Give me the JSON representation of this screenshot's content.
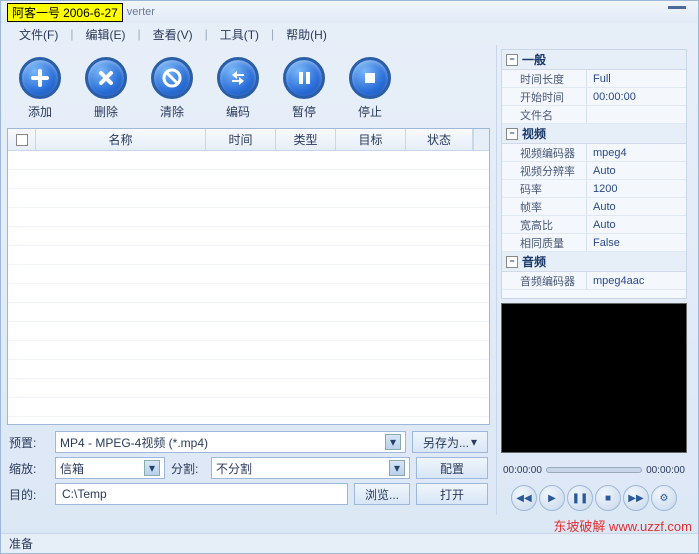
{
  "title": {
    "badge_name": "阿客一号",
    "badge_date": "2006-6-27",
    "suffix": "verter"
  },
  "menu": {
    "items": [
      "文件(F)",
      "编辑(E)",
      "查看(V)",
      "工具(T)",
      "帮助(H)"
    ]
  },
  "toolbar": {
    "add": "添加",
    "delete": "删除",
    "clear": "清除",
    "encode": "编码",
    "pause": "暂停",
    "stop": "停止"
  },
  "grid": {
    "cols": {
      "check": "",
      "name": "名称",
      "time": "时间",
      "type": "类型",
      "target": "目标",
      "status": "状态"
    }
  },
  "bottom": {
    "preset_label": "预置:",
    "preset_value": "MP4 - MPEG-4视频 (*.mp4)",
    "saveas": "另存为...",
    "scale_label": "缩放:",
    "scale_value": "信箱",
    "split_label": "分割:",
    "split_value": "不分割",
    "config": "配置",
    "dest_label": "目的:",
    "dest_value": "C:\\Temp",
    "browse": "浏览...",
    "open": "打开"
  },
  "props": {
    "g1": {
      "title": "一般",
      "rows": [
        {
          "k": "时间长度",
          "v": "Full"
        },
        {
          "k": "开始时间",
          "v": "00:00:00"
        },
        {
          "k": "文件名",
          "v": ""
        }
      ]
    },
    "g2": {
      "title": "视频",
      "rows": [
        {
          "k": "视频编码器",
          "v": "mpeg4"
        },
        {
          "k": "视频分辨率",
          "v": "Auto"
        },
        {
          "k": "码率",
          "v": "1200"
        },
        {
          "k": "帧率",
          "v": "Auto"
        },
        {
          "k": "宽高比",
          "v": "Auto"
        },
        {
          "k": "相同质量",
          "v": "False"
        }
      ]
    },
    "g3": {
      "title": "音频",
      "rows": [
        {
          "k": "音频编码器",
          "v": "mpeg4aac"
        }
      ]
    }
  },
  "player": {
    "t1": "00:00:00",
    "t2": "00:00:00"
  },
  "status": {
    "text": "准备"
  },
  "watermark": {
    "text": "东坡破解 www.uzzf.com"
  }
}
